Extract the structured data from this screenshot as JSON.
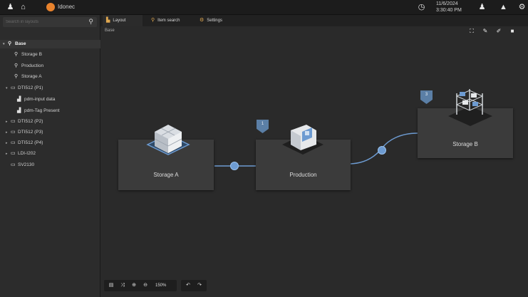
{
  "topbar": {
    "app_name": "Idonec",
    "date": "11/6/2024",
    "time": "3:30:40 PM",
    "icons": [
      "person-icon",
      "home-icon",
      "clock-icon",
      "user-icon",
      "alert-icon",
      "settings-icon"
    ]
  },
  "sidebar": {
    "search_placeholder": "Search in layouts",
    "items": [
      {
        "label": "Base",
        "icon": "location-icon",
        "caret": "▾",
        "selected": true
      },
      {
        "label": "Storage B",
        "icon": "location-icon",
        "caret": ""
      },
      {
        "label": "Production",
        "icon": "location-icon",
        "caret": ""
      },
      {
        "label": "Storage A",
        "icon": "location-icon",
        "caret": ""
      },
      {
        "label": "DTI512 (P1)",
        "icon": "device-icon",
        "caret": "▾"
      },
      {
        "label": "pdm-input data",
        "icon": "data-icon",
        "caret": ""
      },
      {
        "label": "pdm-Tag Present",
        "icon": "data-icon",
        "caret": ""
      },
      {
        "label": "DTI512 (P2)",
        "icon": "device-icon",
        "caret": "▸"
      },
      {
        "label": "DTI512 (P3)",
        "icon": "device-icon",
        "caret": "▸"
      },
      {
        "label": "DTI512 (P4)",
        "icon": "device-icon",
        "caret": "▸"
      },
      {
        "label": "LDI-I202",
        "icon": "device-icon",
        "caret": "▸"
      },
      {
        "label": "SV2130",
        "icon": "device-icon",
        "caret": ""
      }
    ]
  },
  "tabs": [
    {
      "label": "Layout",
      "icon": "layout-icon"
    },
    {
      "label": "Item search",
      "icon": "search-items-icon"
    },
    {
      "label": "Settings",
      "icon": "settings-icon"
    }
  ],
  "canvas": {
    "breadcrumb": "Base",
    "nodes": {
      "storage_a": {
        "label": "Storage A"
      },
      "production": {
        "label": "Production",
        "badge": "1"
      },
      "storage_b": {
        "label": "Storage B",
        "badge": "3"
      }
    }
  },
  "zoombar": {
    "zoom": "150%"
  },
  "colors": {
    "connector": "#6d9bd1",
    "badge": "#5b7fa6",
    "accent": "#e8822c"
  }
}
